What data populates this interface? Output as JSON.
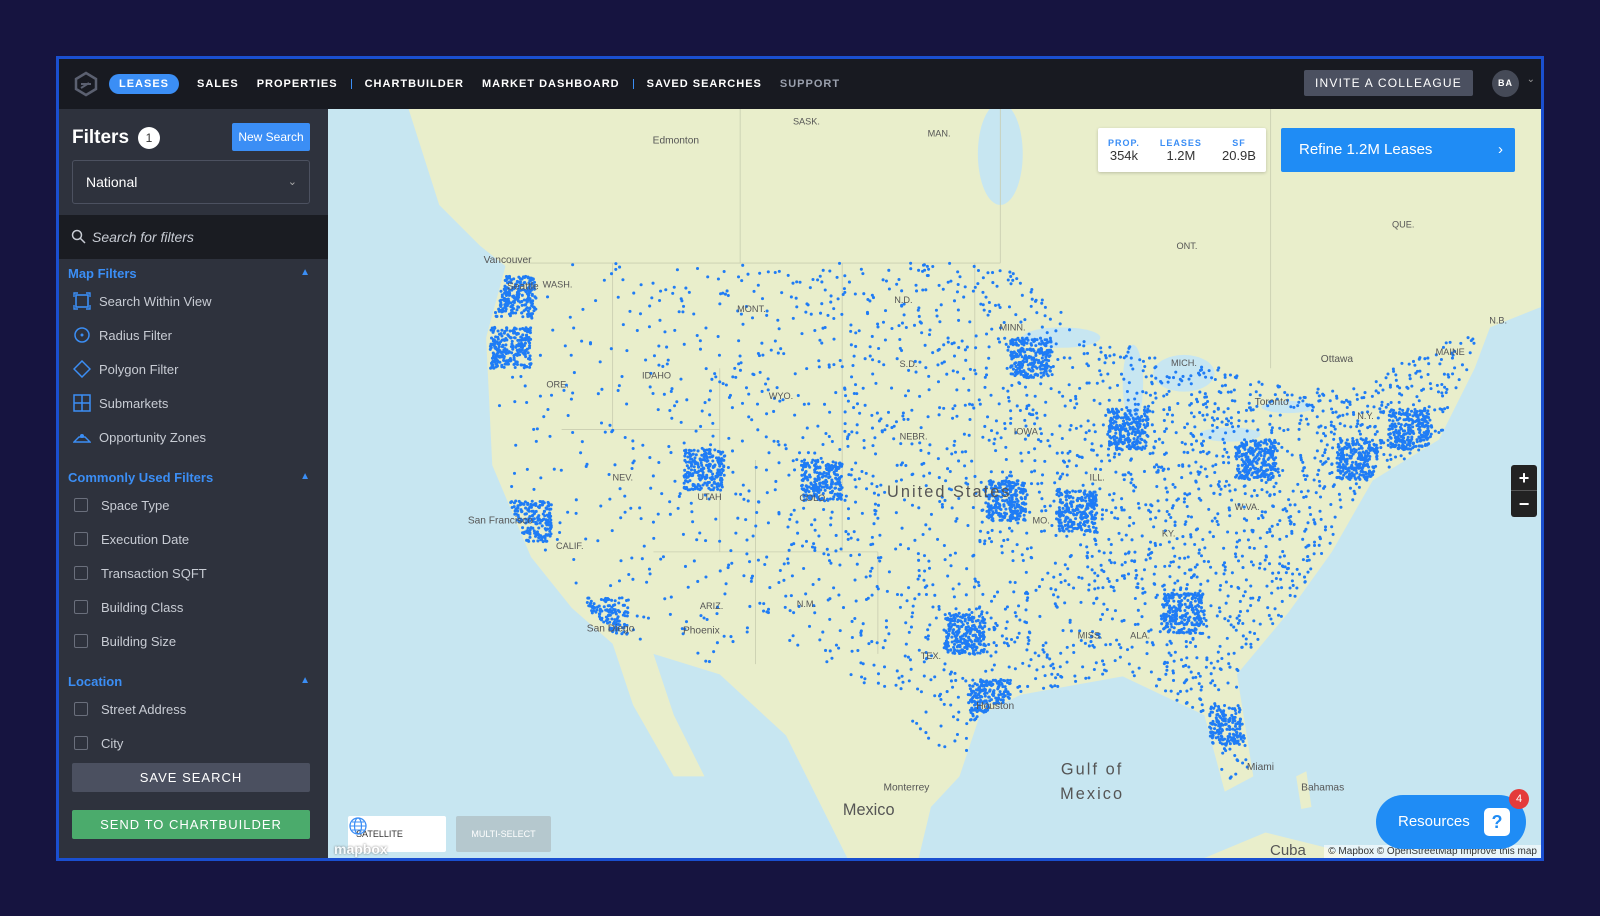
{
  "nav": {
    "items": [
      "LEASES",
      "SALES",
      "PROPERTIES",
      "CHARTBUILDER",
      "MARKET DASHBOARD",
      "SAVED SEARCHES",
      "SUPPORT"
    ],
    "active": "LEASES",
    "invite_label": "INVITE A COLLEAGUE",
    "avatar_initials": "BA"
  },
  "sidebar": {
    "title": "Filters",
    "filter_count": "1",
    "new_search_label": "New Search",
    "region_value": "National",
    "search_placeholder": "Search for filters",
    "sections": [
      {
        "title": "Map Filters",
        "items": [
          {
            "label": "Search Within View",
            "icon": "search-within-view-icon"
          },
          {
            "label": "Radius Filter",
            "icon": "radius-icon"
          },
          {
            "label": "Polygon Filter",
            "icon": "polygon-icon"
          },
          {
            "label": "Submarkets",
            "icon": "grid-icon"
          },
          {
            "label": "Opportunity Zones",
            "icon": "opportunity-zone-icon"
          }
        ]
      },
      {
        "title": "Commonly Used Filters",
        "items": [
          {
            "label": "Space Type"
          },
          {
            "label": "Execution Date"
          },
          {
            "label": "Transaction SQFT"
          },
          {
            "label": "Building Class"
          },
          {
            "label": "Building Size"
          }
        ]
      },
      {
        "title": "Location",
        "items": [
          {
            "label": "Street Address"
          },
          {
            "label": "City"
          }
        ]
      }
    ],
    "save_search_label": "SAVE SEARCH",
    "send_chartbuilder_label": "SEND TO CHARTBUILDER"
  },
  "map": {
    "stats": [
      {
        "label": "PROP.",
        "value": "354k"
      },
      {
        "label": "LEASES",
        "value": "1.2M"
      },
      {
        "label": "SF",
        "value": "20.9B"
      }
    ],
    "refine_label": "Refine 1.2M Leases",
    "zoom_in": "+",
    "zoom_out": "−",
    "satellite_label": "SATELLITE",
    "multiselect_label": "MULTI-SELECT",
    "mapbox_logo": "mapbox",
    "attribution": "© Mapbox © OpenStreetMap  Improve this map",
    "resources_label": "Resources",
    "resources_badge": "4",
    "dot_color": "#1f7cf5",
    "labels": {
      "sask": "SASK.",
      "man": "MAN.",
      "edmonton": "Edmonton",
      "ont": "ONT.",
      "que": "QUE.",
      "nb": "N.B.",
      "vancouver": "Vancouver",
      "seattle": "Seattle",
      "wash": "WASH.",
      "mont": "MONT.",
      "nd": "N.D.",
      "minn": "MINN.",
      "ore": "ORE.",
      "idaho": "IDAHO",
      "sd": "S.D.",
      "wyo": "WYO.",
      "mich": "MICH.",
      "ottawa": "Ottawa",
      "maine": "MAINE",
      "toronto": "Toronto",
      "ny": "N.Y.",
      "nebr": "NEBR.",
      "iowa": "IOWA",
      "nev": "NEV.",
      "utah": "UTAH",
      "united_states": "United States",
      "colo": "COLO.",
      "wva": "W.VA.",
      "mo": "MO.",
      "sf": "San Francisco",
      "calif": "CALIF.",
      "ky": "KY.",
      "arizona": "ARIZ.",
      "nm": "N.M.",
      "tex": "TEX.",
      "sd_city": "San Diego",
      "phoenix": "Phoenix",
      "houston": "Houston",
      "miami": "Miami",
      "bahamas": "Bahamas",
      "gulf": "Gulf of",
      "mexico_gulf": "Mexico",
      "monterrey": "Monterrey",
      "mexico": "Mexico",
      "cuba": "Cuba",
      "ill": "ILL.",
      "ala": "ALA.",
      "miss": "MISS."
    }
  }
}
